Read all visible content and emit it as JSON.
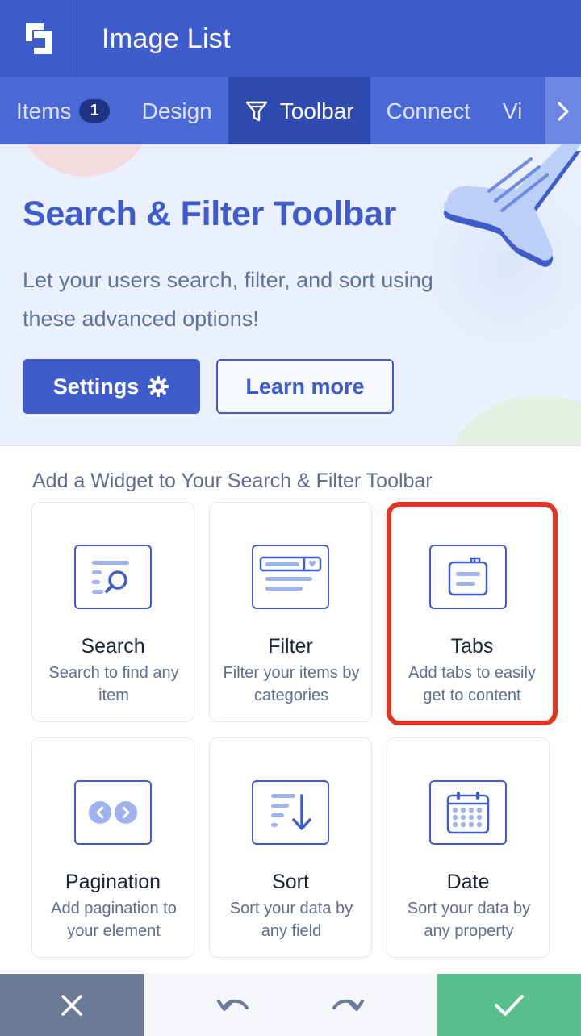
{
  "app": {
    "title": "Image List"
  },
  "tabs": [
    {
      "label": "Items",
      "badge": "1",
      "active": false
    },
    {
      "label": "Design",
      "active": false
    },
    {
      "label": "Toolbar",
      "active": true,
      "icon": "filter-icon"
    },
    {
      "label": "Connect",
      "active": false
    },
    {
      "label": "Vi",
      "active": false
    }
  ],
  "hero": {
    "title": "Search & Filter Toolbar",
    "description": "Let your users search, filter, and sort using these advanced options!",
    "settings_label": "Settings",
    "learn_more_label": "Learn more"
  },
  "widgets": {
    "section_title": "Add a Widget to Your Search & Filter Toolbar",
    "items": [
      {
        "title": "Search",
        "description": "Search to find any item",
        "icon": "search-icon"
      },
      {
        "title": "Filter",
        "description": "Filter your items by categories",
        "icon": "filter-widget-icon"
      },
      {
        "title": "Tabs",
        "description": "Add tabs to easily get to content",
        "icon": "tabs-icon",
        "highlighted": true
      },
      {
        "title": "Pagination",
        "description": "Add pagination to your element",
        "icon": "pagination-icon"
      },
      {
        "title": "Sort",
        "description": "Sort your data by any field",
        "icon": "sort-icon"
      },
      {
        "title": "Date",
        "description": "Sort your data by any property",
        "icon": "calendar-icon"
      }
    ]
  },
  "colors": {
    "primary": "#3f5ccc",
    "tab_bar": "#4a68d6",
    "highlight": "#e53323",
    "confirm": "#58c08a",
    "cancel": "#6b7a96"
  }
}
